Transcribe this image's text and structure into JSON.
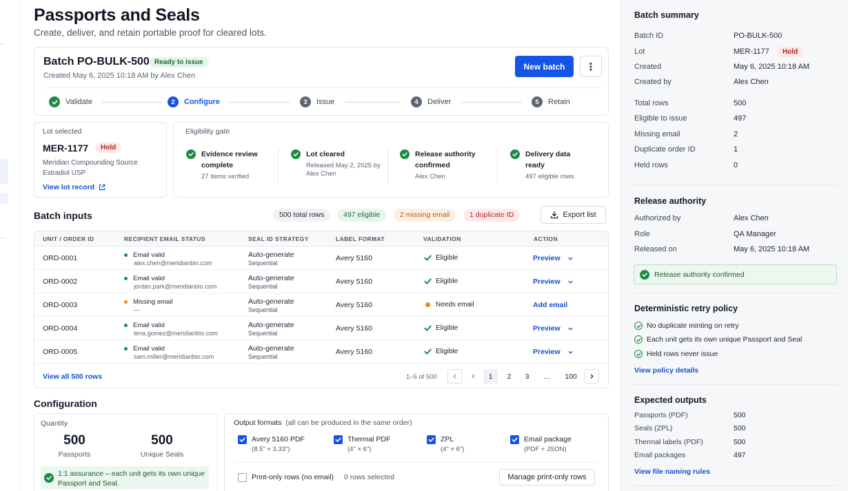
{
  "page": {
    "title": "Passports and Seals",
    "subtitle": "Create, deliver, and retain portable proof for cleared lots."
  },
  "batch": {
    "title": "Batch PO-BULK-500",
    "status": "Ready to issue",
    "created": "Created May 6, 2025 10:18 AM by Alex Chen",
    "new_batch_label": "New batch",
    "more_label": "⋮"
  },
  "steps": [
    {
      "num": "✓",
      "label": "Validate",
      "state": "done"
    },
    {
      "num": "2",
      "label": "Configure",
      "state": "active"
    },
    {
      "num": "3",
      "label": "Issue",
      "state": "pending"
    },
    {
      "num": "4",
      "label": "Deliver",
      "state": "pending"
    },
    {
      "num": "5",
      "label": "Retain",
      "state": "pending"
    }
  ],
  "lot": {
    "heading": "Lot selected",
    "id": "MER-1177",
    "status": "Hold",
    "description": "Meridian Compounding Source Estradiol USP",
    "link": "View lot record"
  },
  "eligibility": {
    "heading": "Eligibility gate",
    "items": [
      {
        "title": "Evidence review complete",
        "sub": "27 items verified"
      },
      {
        "title": "Lot cleared",
        "sub": "Released May 2, 2025 by Alex Chen"
      },
      {
        "title": "Release authority confirmed",
        "sub": "Alex Chen"
      },
      {
        "title": "Delivery data ready",
        "sub": "497 eligible rows"
      }
    ]
  },
  "inputs": {
    "heading": "Batch inputs",
    "counts": {
      "total": "500 total rows",
      "eligible": "497 eligible",
      "missing": "2 missing email",
      "duplicate": "1 duplicate ID"
    },
    "export_label": "Export list",
    "columns": [
      "UNIT / ORDER ID",
      "RECIPIENT EMAIL STATUS",
      "SEAL ID STRATEGY",
      "LABEL FORMAT",
      "VALIDATION",
      "ACTION"
    ],
    "rows": [
      {
        "id": "ORD-0001",
        "email_status": "Email valid",
        "email": "alex.chen@meridianbio.com",
        "seal": "Auto-generate",
        "seal_mode": "Sequential",
        "label": "Avery 5160",
        "validation": "Eligible",
        "action": "Preview",
        "ok": true
      },
      {
        "id": "ORD-0002",
        "email_status": "Email valid",
        "email": "jordan.park@meridianbio.com",
        "seal": "Auto-generate",
        "seal_mode": "Sequential",
        "label": "Avery 5160",
        "validation": "Eligible",
        "action": "Preview",
        "ok": true
      },
      {
        "id": "ORD-0003",
        "email_status": "Missing email",
        "email": "—",
        "seal": "Auto-generate",
        "seal_mode": "Sequential",
        "label": "Avery 5160",
        "validation": "Needs email",
        "action": "Add email",
        "ok": false
      },
      {
        "id": "ORD-0004",
        "email_status": "Email valid",
        "email": "lena.gomez@meridianbio.com",
        "seal": "Auto-generate",
        "seal_mode": "Sequential",
        "label": "Avery 5160",
        "validation": "Eligible",
        "action": "Preview",
        "ok": true
      },
      {
        "id": "ORD-0005",
        "email_status": "Email valid",
        "email": "sam.miller@meridianbio.com",
        "seal": "Auto-generate",
        "seal_mode": "Sequential",
        "label": "Avery 5160",
        "validation": "Eligible",
        "action": "Preview",
        "ok": true
      }
    ],
    "view_all": "View all 500 rows",
    "pager": {
      "info": "1–5 of 500",
      "pages": [
        "1",
        "2",
        "3",
        "…",
        "100"
      ],
      "current": "1"
    }
  },
  "configuration": {
    "heading": "Configuration",
    "quantity": {
      "heading": "Quantity",
      "passports_value": "500",
      "passports_label": "Passports",
      "seals_value": "500",
      "seals_label": "Unique Seals",
      "assurance": "1:1 assurance – each unit gets its own unique Passport and Seal."
    },
    "outputs": {
      "heading": "Output formats",
      "note": "(all can be produced in the same order)",
      "formats": [
        {
          "name": "Avery 5160 PDF",
          "size": "(8.5\" × 3.33\")",
          "checked": true
        },
        {
          "name": "Thermal PDF",
          "size": "(4\" × 6\")",
          "checked": true
        },
        {
          "name": "ZPL",
          "size": "(4\" × 6\")",
          "checked": true
        },
        {
          "name": "Email package",
          "size": "(PDF + JSON)",
          "checked": true
        }
      ],
      "print_only_label": "Print-only rows (no email)",
      "print_only_checked": false,
      "rows_selected": "0 rows selected",
      "manage_label": "Manage print-only rows"
    }
  },
  "summary": {
    "heading": "Batch summary",
    "fields": [
      {
        "k": "Batch ID",
        "v": "PO-BULK-500"
      },
      {
        "k": "Lot",
        "v": "MER-1177"
      },
      {
        "k": "Created",
        "v": "May 6, 2025 10:18 AM"
      },
      {
        "k": "Created by",
        "v": "Alex Chen"
      }
    ],
    "lot_status": "Hold",
    "stats": [
      {
        "k": "Total rows",
        "v": "500"
      },
      {
        "k": "Eligible to issue",
        "v": "497"
      },
      {
        "k": "Missing email",
        "v": "2"
      },
      {
        "k": "Duplicate order ID",
        "v": "1"
      },
      {
        "k": "Held rows",
        "v": "0"
      }
    ],
    "release": {
      "heading": "Release authority",
      "fields": [
        {
          "k": "Authorized by",
          "v": "Alex Chen"
        },
        {
          "k": "Role",
          "v": "QA Manager"
        },
        {
          "k": "Released on",
          "v": "May 6, 2025 10:18 AM"
        }
      ],
      "confirmed": "Release authority confirmed"
    },
    "policy": {
      "heading": "Deterministic retry policy",
      "items": [
        "No duplicate minting on retry",
        "Each unit gets its own unique Passport and Seal",
        "Held rows never issue"
      ],
      "link": "View policy details"
    },
    "outputs": {
      "heading": "Expected outputs",
      "items": [
        {
          "k": "Passports (PDF)",
          "v": "500"
        },
        {
          "k": "Seals (ZPL)",
          "v": "500"
        },
        {
          "k": "Thermal labels (PDF)",
          "v": "500"
        },
        {
          "k": "Email packages",
          "v": "497"
        }
      ],
      "link": "View file naming rules"
    }
  },
  "colors": {
    "primary": "#1455e6",
    "success": "#1e8a46",
    "warning": "#f08a12",
    "danger": "#b42323"
  }
}
